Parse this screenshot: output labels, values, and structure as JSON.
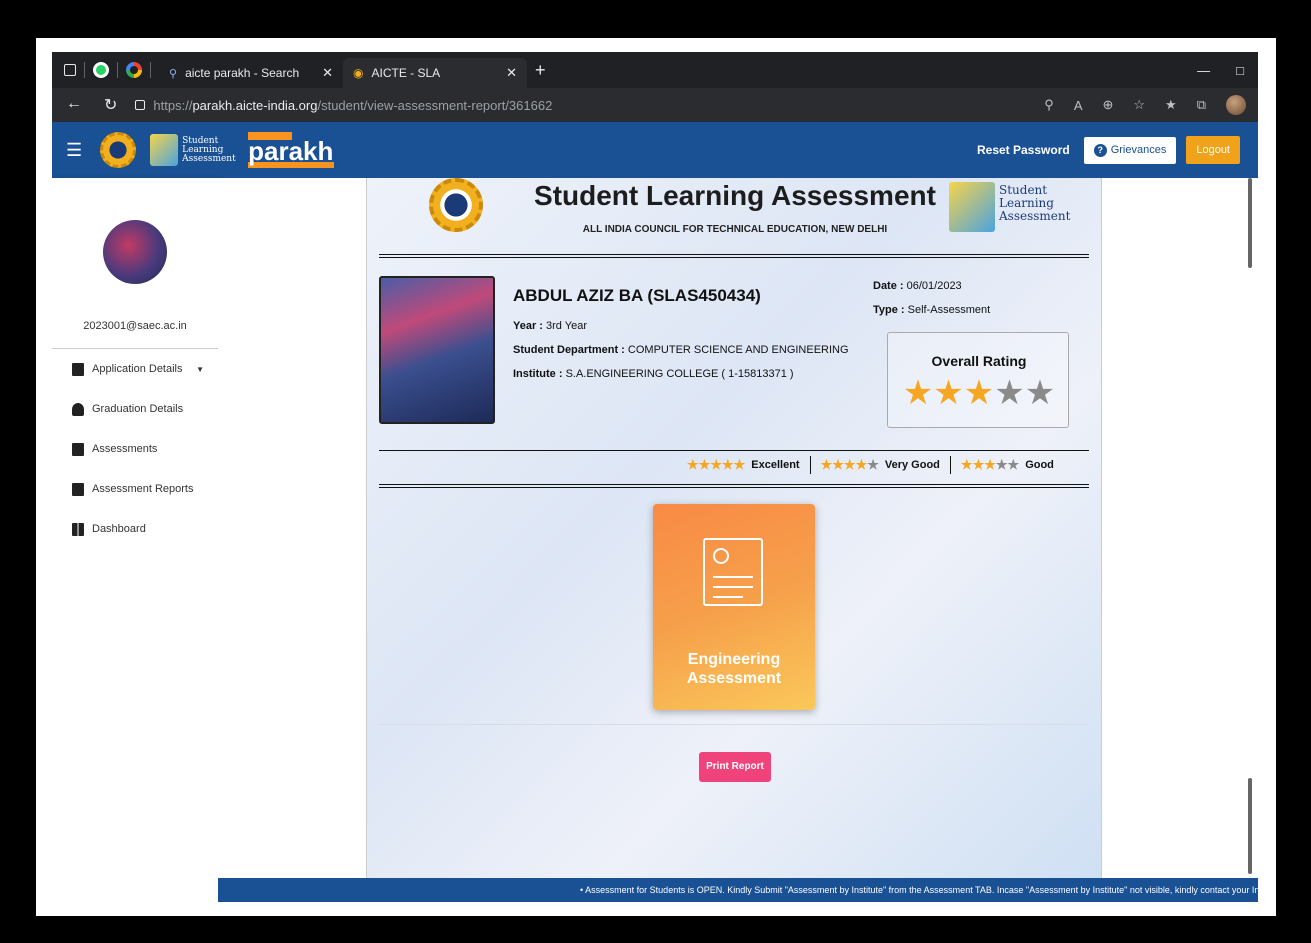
{
  "browser": {
    "tabs": [
      {
        "title": "aicte parakh - Search",
        "active": false
      },
      {
        "title": "AICTE - SLA",
        "active": true
      }
    ],
    "url_prefix": "https://",
    "url_host": "parakh.aicte-india.org",
    "url_path": "/student/view-assessment-report/361662"
  },
  "header": {
    "sla_logo_text": "Student Learning Assessment",
    "parakh_word": "parakh",
    "reset_password": "Reset Password",
    "grievances": "Grievances",
    "logout": "Logout"
  },
  "sidebar": {
    "email": "2023001@saec.ac.in",
    "items": [
      {
        "label": "Application Details",
        "icon": "file-icon"
      },
      {
        "label": "Graduation Details",
        "icon": "graduation-cap-icon"
      },
      {
        "label": "Assessments",
        "icon": "clipboard-icon"
      },
      {
        "label": "Assessment Reports",
        "icon": "clipboard-check-icon"
      },
      {
        "label": "Dashboard",
        "icon": "dashboard-icon"
      }
    ]
  },
  "report": {
    "title": "Student Learning Assessment",
    "subtitle": "ALL INDIA COUNCIL FOR TECHNICAL EDUCATION, NEW DELHI",
    "logo_text": [
      "Student",
      "Learning",
      "Assessment"
    ],
    "student_name": "ABDUL AZIZ BA (SLAS450434)",
    "year_label": "Year :",
    "year_value": "3rd Year",
    "dept_label": "Student Department :",
    "dept_value": "COMPUTER SCIENCE AND ENGINEERING",
    "inst_label": "Institute :",
    "inst_value": "S.A.ENGINEERING COLLEGE ( 1-15813371 )",
    "date_label": "Date :",
    "date_value": "06/01/2023",
    "type_label": "Type :",
    "type_value": "Self-Assessment",
    "overall_rating_label": "Overall Rating",
    "overall_rating": 3,
    "rating_max": 5,
    "legend": [
      {
        "stars": 5,
        "label": "Excellent"
      },
      {
        "stars": 4,
        "label": "Very Good"
      },
      {
        "stars": 3,
        "label": "Good"
      }
    ],
    "assessment_card": "Engineering Assessment",
    "print_button": "Print Report"
  },
  "ticker": "• Assessment for Students is OPEN. Kindly Submit \"Assessment by Institute\" from the Assessment TAB. Incase \"Assessment by Institute\" not visible, kindly contact your Institute",
  "colors": {
    "header": "#1a5094",
    "logout": "#f0a21b",
    "print": "#f0437c",
    "star_on": "#f5a623",
    "star_off": "#8a8a8a"
  }
}
